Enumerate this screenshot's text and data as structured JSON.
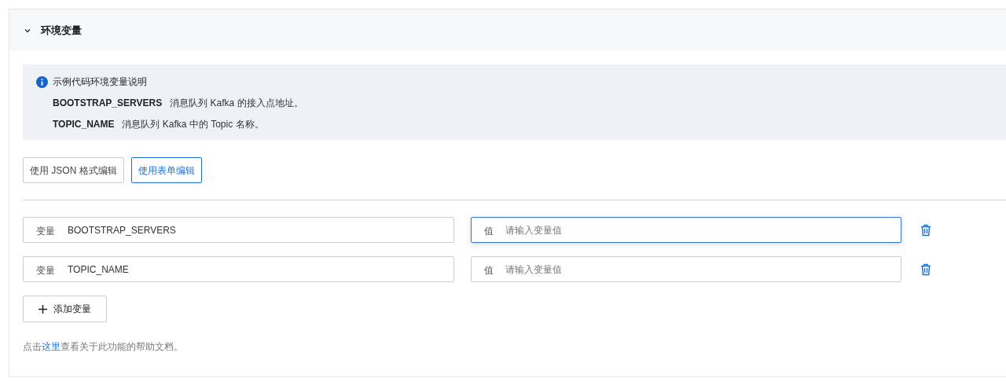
{
  "section": {
    "title": "环境变量",
    "expanded": true
  },
  "info": {
    "title": "示例代码环境变量说明",
    "items": [
      {
        "name": "BOOTSTRAP_SERVERS",
        "description": "消息队列 Kafka 的接入点地址。"
      },
      {
        "name": "TOPIC_NAME",
        "description": "消息队列 Kafka 中的 Topic 名称。"
      }
    ]
  },
  "mode_buttons": [
    {
      "label": "使用 JSON 格式编辑",
      "selected": false
    },
    {
      "label": "使用表单编辑",
      "selected": true
    }
  ],
  "variables": [
    {
      "name_label": "变量",
      "name": "BOOTSTRAP_SERVERS",
      "value_label": "值",
      "value_placeholder": "请输入变量值",
      "focused": true
    },
    {
      "name_label": "变量",
      "name": "TOPIC_NAME",
      "value_label": "值",
      "value_placeholder": "请输入变量值",
      "focused": false
    }
  ],
  "add_button": "添加变量",
  "help": {
    "before": "点击",
    "link": "这里",
    "after": "查看关于此功能的帮助文档。"
  }
}
